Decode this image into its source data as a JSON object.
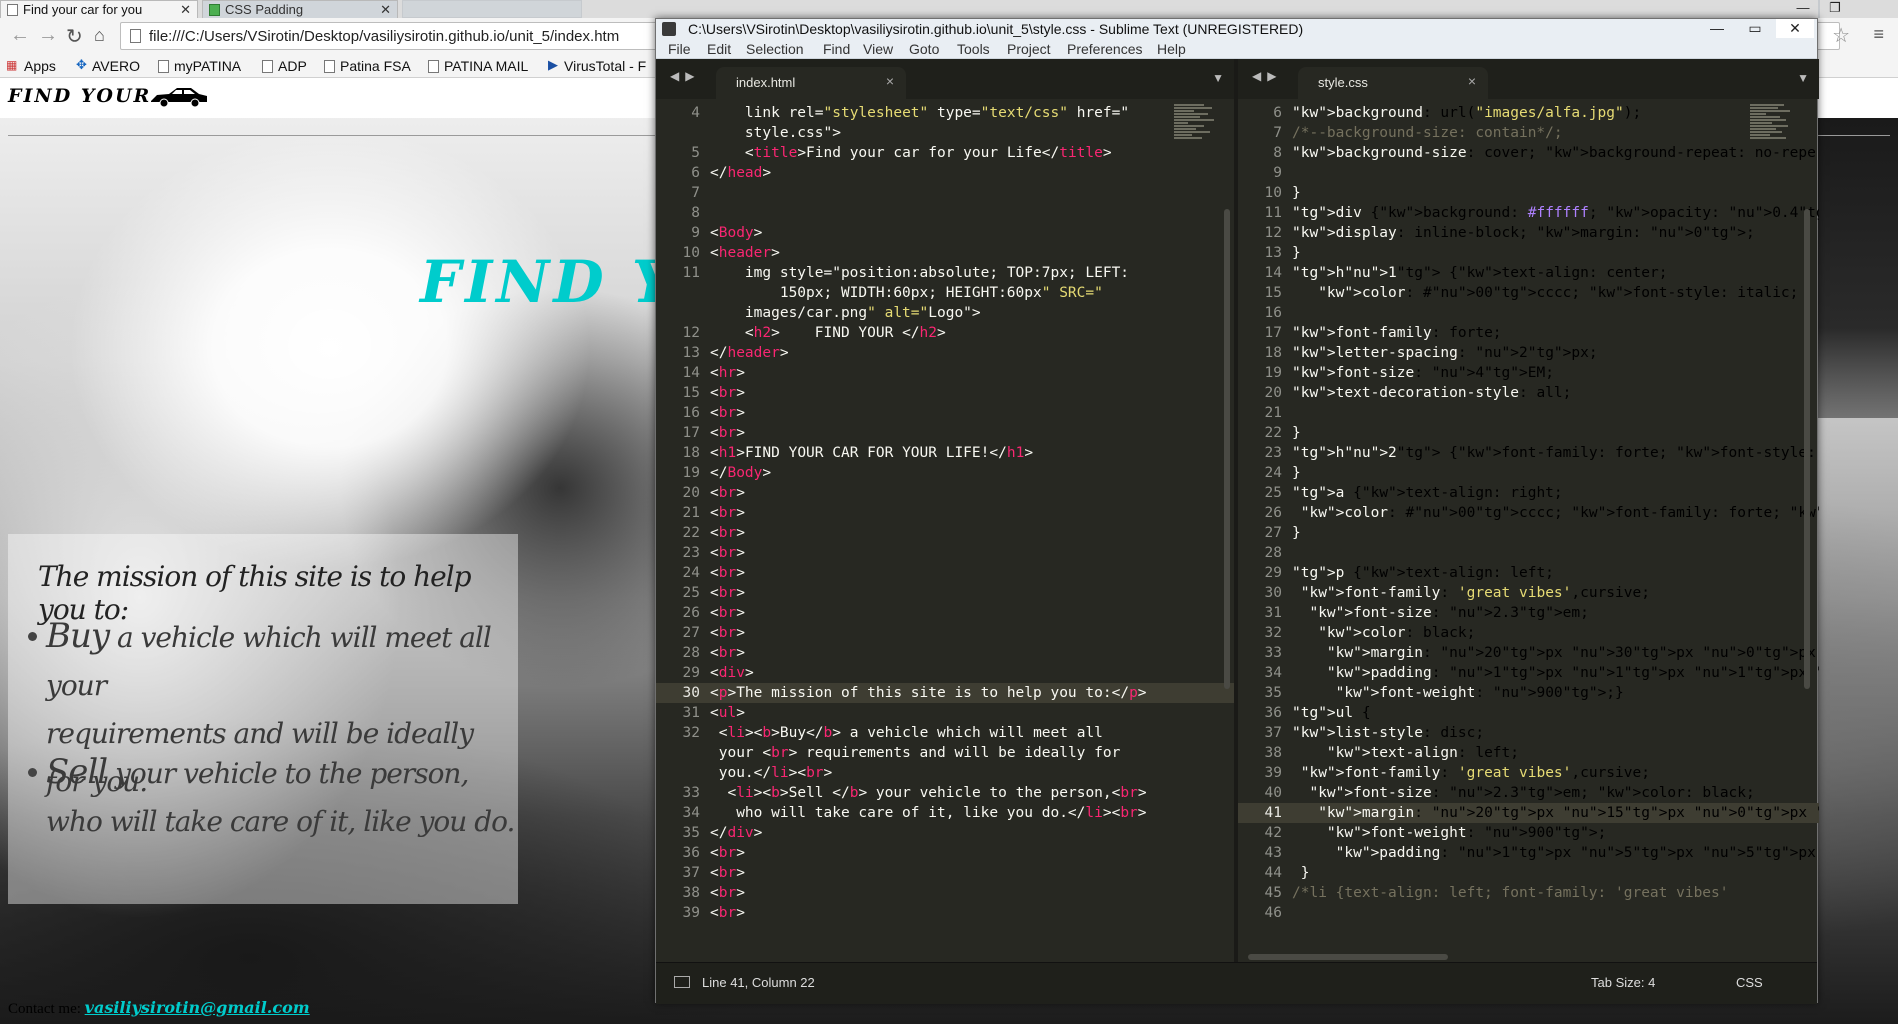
{
  "browser": {
    "tabs": [
      {
        "title": "Find your car for you"
      },
      {
        "title": "CSS Padding"
      }
    ],
    "url": "file:///C:/Users/VSirotin/Desktop/vasiliysirotin.github.io/unit_5/index.htm",
    "bookmarks": [
      "Apps",
      "AVERO",
      "myPATINA",
      "ADP",
      "Patina FSA",
      "PATINA MAIL",
      "VirusTotal - F"
    ]
  },
  "page": {
    "logo_text": "FIND YOUR",
    "title": "FIND Y",
    "mission": "The mission of this site is to help you to:",
    "items": [
      {
        "bold": "Buy",
        "line1": " a vehicle which will meet all your",
        "line2": "requirements and will be ideally for you."
      },
      {
        "bold": "Sell",
        "line1": " your vehicle to the person,",
        "line2": "who will take care of it, like you do."
      }
    ],
    "contact_label": "Contact me:",
    "contact_email": "vasiliysirotin@gmail.com"
  },
  "sublime": {
    "title": "C:\\Users\\VSirotin\\Desktop\\vasiliysirotin.github.io\\unit_5\\style.css - Sublime Text (UNREGISTERED)",
    "menu": [
      "File",
      "Edit",
      "Selection",
      "Find",
      "View",
      "Goto",
      "Tools",
      "Project",
      "Preferences",
      "Help"
    ],
    "left_tab": "index.html",
    "right_tab": "style.css",
    "status_position": "Line 41, Column 22",
    "status_tab_size": "Tab Size: 4",
    "status_syntax": "CSS",
    "current_line_left": "30",
    "current_line_right": "41",
    "html_lines": [
      {
        "n": "4",
        "code": "    <link rel=\"stylesheet\" type=\"text/css\" href=\""
      },
      {
        "n": "",
        "code": "    style.css\">"
      },
      {
        "n": "5",
        "code": "    <title>Find your car for your Life</title>"
      },
      {
        "n": "6",
        "code": "</head>"
      },
      {
        "n": "7",
        "code": ""
      },
      {
        "n": "8",
        "code": ""
      },
      {
        "n": "9",
        "code": "<Body>"
      },
      {
        "n": "10",
        "code": "<header>"
      },
      {
        "n": "11",
        "code": "    <img style=\"position:absolute; TOP:7px; LEFT:"
      },
      {
        "n": "",
        "code": "        150px; WIDTH:60px; HEIGHT:60px\" SRC=\""
      },
      {
        "n": "",
        "code": "    images/car.png\" alt=\"Logo\">"
      },
      {
        "n": "12",
        "code": "    <h2>    FIND YOUR </h2>"
      },
      {
        "n": "13",
        "code": "</header>"
      },
      {
        "n": "14",
        "code": "<hr>"
      },
      {
        "n": "15",
        "code": "<br>"
      },
      {
        "n": "16",
        "code": "<br>"
      },
      {
        "n": "17",
        "code": "<br>"
      },
      {
        "n": "18",
        "code": "<h1>FIND YOUR CAR FOR YOUR LIFE!</h1>"
      },
      {
        "n": "19",
        "code": "</Body>"
      },
      {
        "n": "20",
        "code": "<br>"
      },
      {
        "n": "21",
        "code": "<br>"
      },
      {
        "n": "22",
        "code": "<br>"
      },
      {
        "n": "23",
        "code": "<br>"
      },
      {
        "n": "24",
        "code": "<br>"
      },
      {
        "n": "25",
        "code": "<br>"
      },
      {
        "n": "26",
        "code": "<br>"
      },
      {
        "n": "27",
        "code": "<br>"
      },
      {
        "n": "28",
        "code": "<br>"
      },
      {
        "n": "29",
        "code": "<div>"
      },
      {
        "n": "30",
        "code": "<p>The mission of this site is to help you to:</p>"
      },
      {
        "n": "31",
        "code": "<ul>"
      },
      {
        "n": "32",
        "code": " <li><b>Buy</b> a vehicle which will meet all"
      },
      {
        "n": "",
        "code": " your <br> requirements and will be ideally for"
      },
      {
        "n": "",
        "code": " you.</li><br>"
      },
      {
        "n": "33",
        "code": "  <li><b>Sell </b> your vehicle to the person,<br>"
      },
      {
        "n": "34",
        "code": "   who will take care of it, like you do.</li><br>"
      },
      {
        "n": "35",
        "code": "</div>"
      },
      {
        "n": "36",
        "code": "<br>"
      },
      {
        "n": "37",
        "code": "<br>"
      },
      {
        "n": "38",
        "code": "<br>"
      },
      {
        "n": "39",
        "code": "<br>"
      },
      {
        "n": "40",
        "code": "<br>"
      }
    ],
    "css_lines": [
      {
        "n": "6",
        "code": "background: url(\"images/alfa.jpg\");"
      },
      {
        "n": "7",
        "code": "/*--background-size: contain*/;"
      },
      {
        "n": "8",
        "code": "background-size: cover; background-repeat: no-repe"
      },
      {
        "n": "9",
        "code": ""
      },
      {
        "n": "10",
        "code": "}"
      },
      {
        "n": "11",
        "code": "div {background: #ffffff; opacity: 0.4;"
      },
      {
        "n": "12",
        "code": "display: inline-block; margin: 0;"
      },
      {
        "n": "13",
        "code": "}"
      },
      {
        "n": "14",
        "code": "h1 {text-align: center;"
      },
      {
        "n": "15",
        "code": "   color: #00cccc; font-style: italic;"
      },
      {
        "n": "16",
        "code": ""
      },
      {
        "n": "17",
        "code": "font-family: forte;"
      },
      {
        "n": "18",
        "code": "letter-spacing: 2px;"
      },
      {
        "n": "19",
        "code": "font-size: 4EM;"
      },
      {
        "n": "20",
        "code": "text-decoration-style: all;"
      },
      {
        "n": "21",
        "code": ""
      },
      {
        "n": "22",
        "code": "}"
      },
      {
        "n": "23",
        "code": "h2 {font-family: forte; font-style: italic;"
      },
      {
        "n": "24",
        "code": "}"
      },
      {
        "n": "25",
        "code": "a {text-align: right;"
      },
      {
        "n": "26",
        "code": " color: #00cccc; font-family: forte; font-size: 20"
      },
      {
        "n": "27",
        "code": "}"
      },
      {
        "n": "28",
        "code": ""
      },
      {
        "n": "29",
        "code": "p {text-align: left;"
      },
      {
        "n": "30",
        "code": " font-family: 'great vibes',cursive;"
      },
      {
        "n": "31",
        "code": "  font-size: 2.3em;"
      },
      {
        "n": "32",
        "code": "   color: black;"
      },
      {
        "n": "33",
        "code": "    margin: 20px 30px 0px 30px;"
      },
      {
        "n": "34",
        "code": "    padding: 1px 1px 1px 1px;"
      },
      {
        "n": "35",
        "code": "     font-weight: 900;}"
      },
      {
        "n": "36",
        "code": "ul {"
      },
      {
        "n": "37",
        "code": "list-style: disc;"
      },
      {
        "n": "38",
        "code": "    text-align: left;"
      },
      {
        "n": "39",
        "code": " font-family: 'great vibes',cursive;"
      },
      {
        "n": "40",
        "code": "  font-size: 2.3em; color: black;"
      },
      {
        "n": "41",
        "code": "   margin: 20px 15px 0px 35px;"
      },
      {
        "n": "42",
        "code": "    font-weight: 900;"
      },
      {
        "n": "43",
        "code": "     padding: 1px 5px 5px 5px;"
      },
      {
        "n": "44",
        "code": " }"
      },
      {
        "n": "45",
        "code": "/*li {text-align: left; font-family: 'great vibes'"
      },
      {
        "n": "46",
        "code": ""
      }
    ]
  }
}
